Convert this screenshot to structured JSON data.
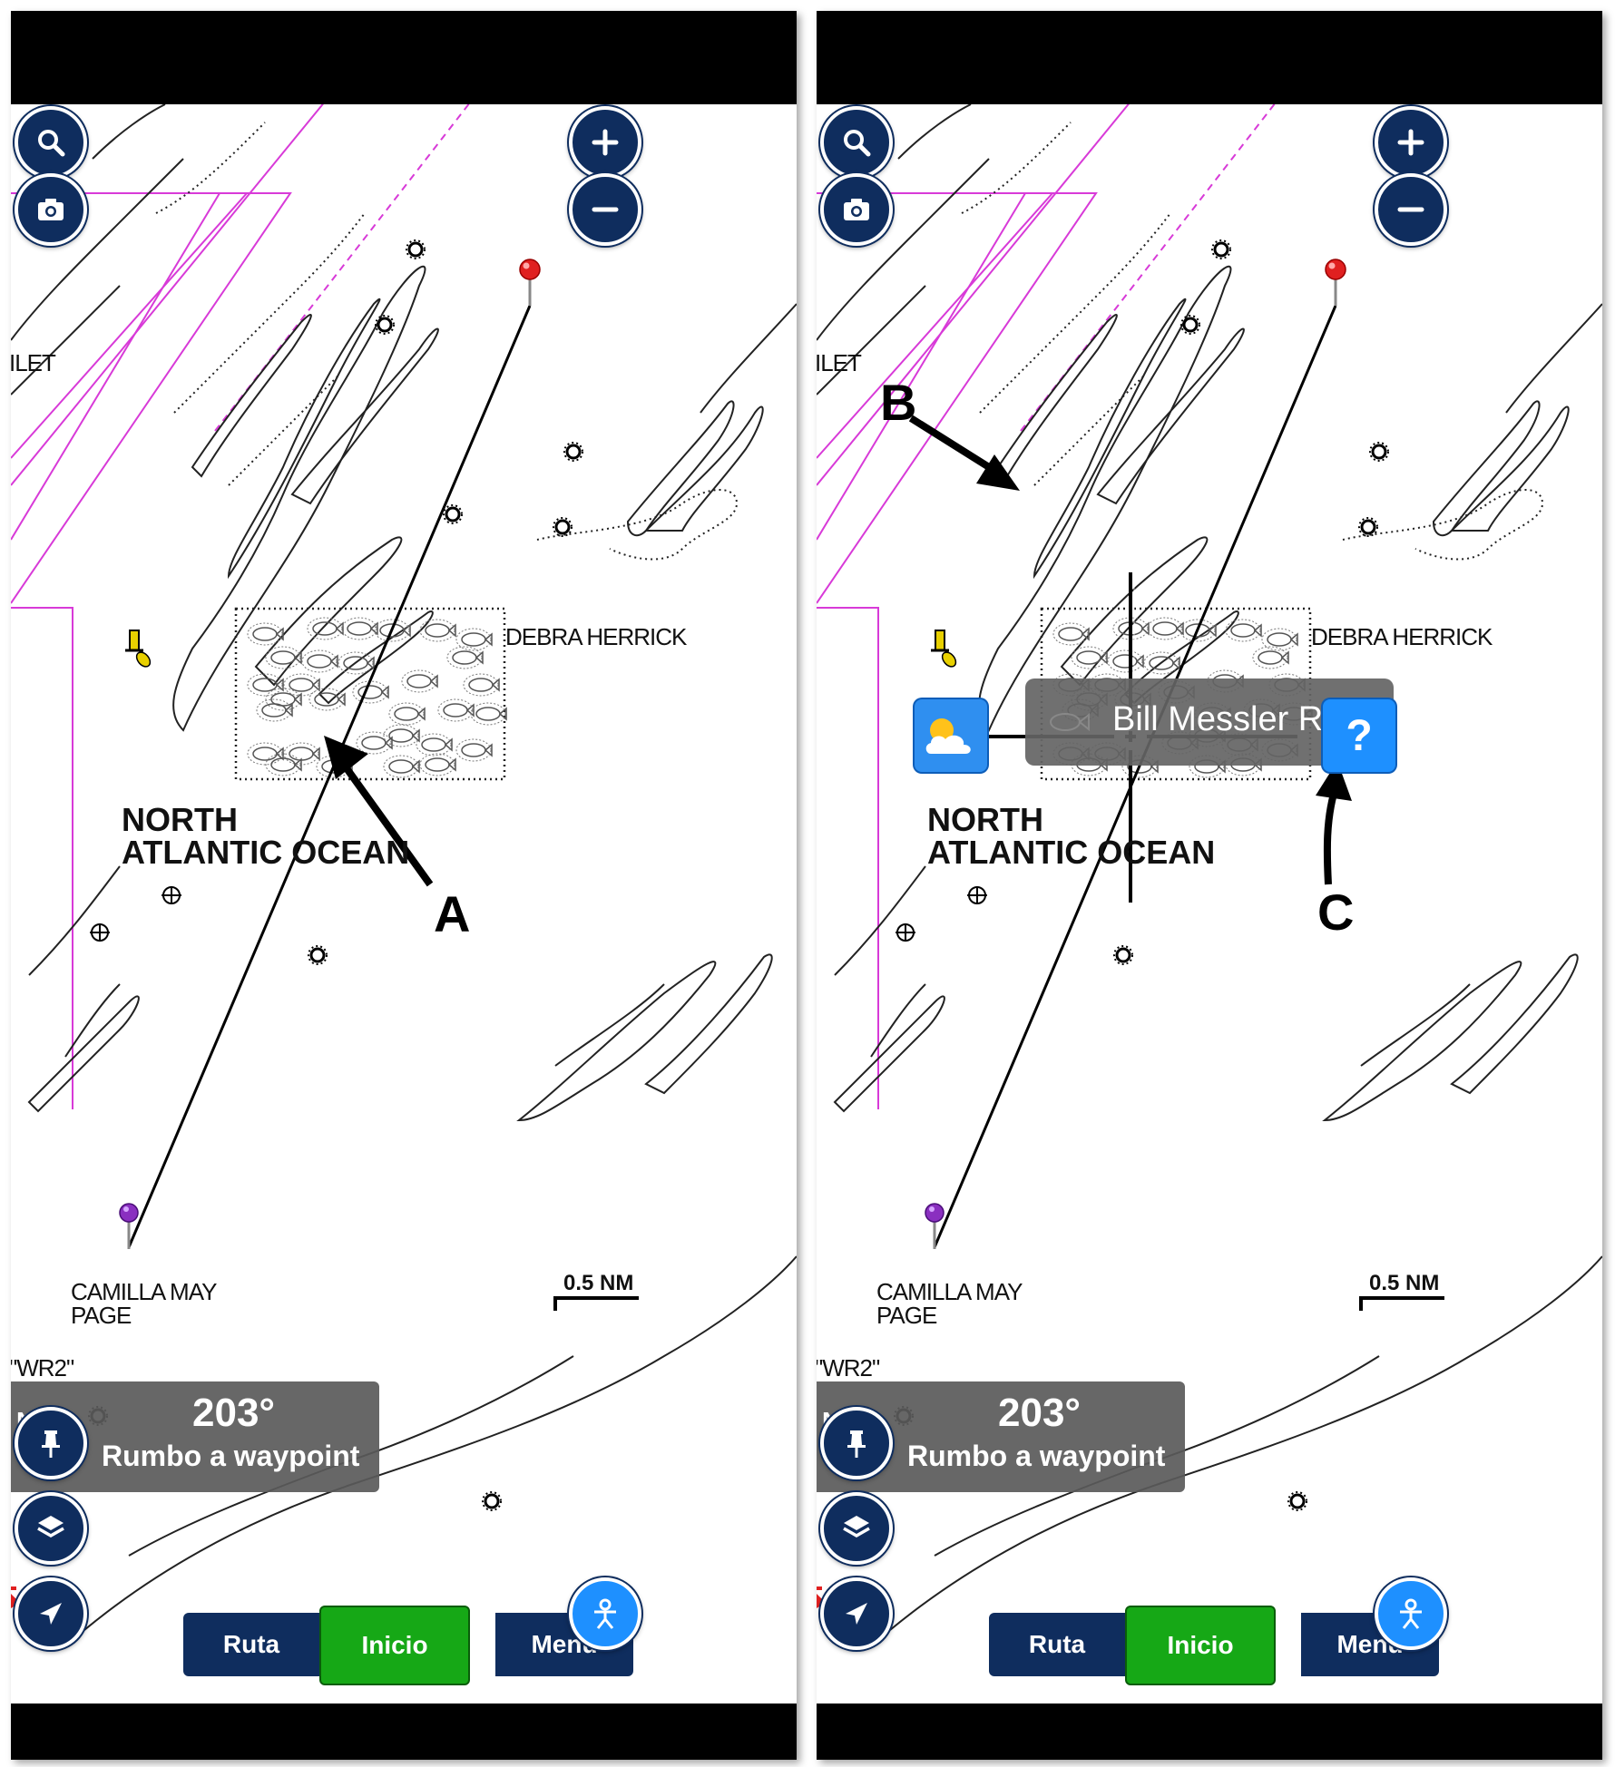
{
  "screens": [
    {
      "id": "left",
      "map": {
        "labels": {
          "inlet": "ILET",
          "debra": "DEBRA HERRICK",
          "ocean_line1": "NORTH",
          "ocean_line2": "ATLANTIC OCEAN",
          "camilla_line1": "CAMILLA MAY",
          "camilla_line2": "PAGE",
          "wr2": "\"WR2\""
        },
        "scale_label": "0.5 NM"
      },
      "info_box": {
        "nm": "NM",
        "heading": "203°",
        "subtitle": "Rumbo a waypoint"
      },
      "nav": {
        "route": "Ruta",
        "home": "Inicio",
        "menu": "Menú"
      },
      "annotations": {
        "a": "A"
      }
    },
    {
      "id": "right",
      "map": {
        "labels": {
          "inlet": "ILET",
          "debra": "DEBRA HERRICK",
          "ocean_line1": "NORTH",
          "ocean_line2": "ATLANTIC OCEAN",
          "camilla_line1": "CAMILLA MAY",
          "camilla_line2": "PAGE",
          "wr2": "\"WR2\""
        },
        "scale_label": "0.5 NM"
      },
      "tooltip": {
        "text": "Bill Messler Reef"
      },
      "query_button": {
        "symbol": "?"
      },
      "info_box": {
        "nm": "NM",
        "heading": "203°",
        "subtitle": "Rumbo a waypoint"
      },
      "nav": {
        "route": "Ruta",
        "home": "Inicio",
        "menu": "Menú"
      },
      "annotations": {
        "b": "B",
        "c": "C"
      }
    }
  ],
  "colors": {
    "button_navy": "#0f2d5e",
    "active_tab_green": "#16a816",
    "boundary_magenta": "#d83ad8",
    "waypoint_red": "#e02020",
    "vessel_purple": "#8a2fc0",
    "query_blue": "#1e90ff"
  },
  "icons": [
    "search-icon",
    "camera-icon",
    "zoom-in-icon",
    "zoom-out-icon",
    "pin-icon",
    "layers-icon",
    "navigation-arrow-icon",
    "person-icon",
    "weather-icon",
    "question-icon",
    "fish-icon",
    "wreck-icon"
  ]
}
